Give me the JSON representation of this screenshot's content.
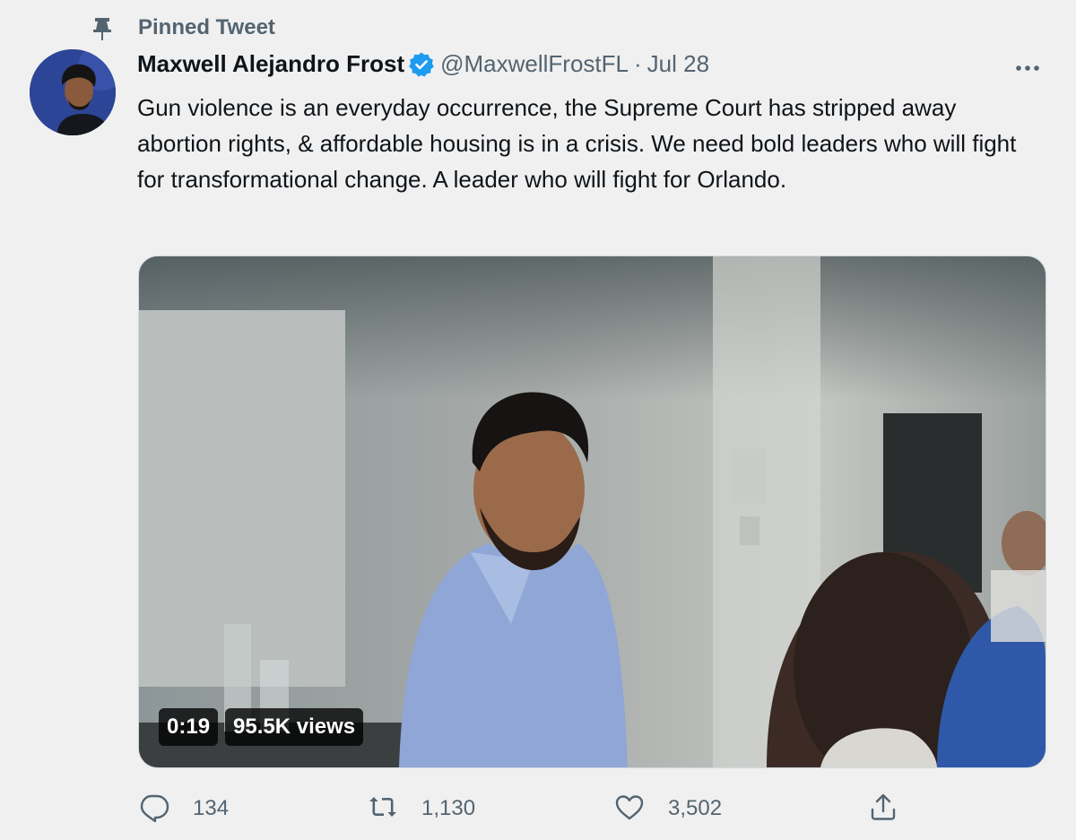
{
  "pinned": {
    "label": "Pinned Tweet",
    "icon": "pin-icon"
  },
  "author": {
    "display_name": "Maxwell Alejandro Frost",
    "handle": "@MaxwellFrostFL",
    "separator": "·",
    "date": "Jul 28",
    "verified_icon": "verified-badge-icon",
    "accent_color": "#1d9bf0"
  },
  "tweet": {
    "text": "Gun violence is an everyday occurrence, the Supreme Court has stripped away abortion rights, & affordable housing is in a crisis. We need bold leaders who will fight for transformational change. A leader who will fight for Orlando."
  },
  "media": {
    "duration": "0:19",
    "views": "95.5K views"
  },
  "actions": {
    "reply_count": "134",
    "retweet_count": "1,130",
    "like_count": "3,502",
    "icons": [
      "reply-icon",
      "retweet-icon",
      "like-icon",
      "share-icon"
    ]
  },
  "colors": {
    "secondary_text": "#536471",
    "primary_text": "#0f1419",
    "background": "#f0f0f0"
  }
}
